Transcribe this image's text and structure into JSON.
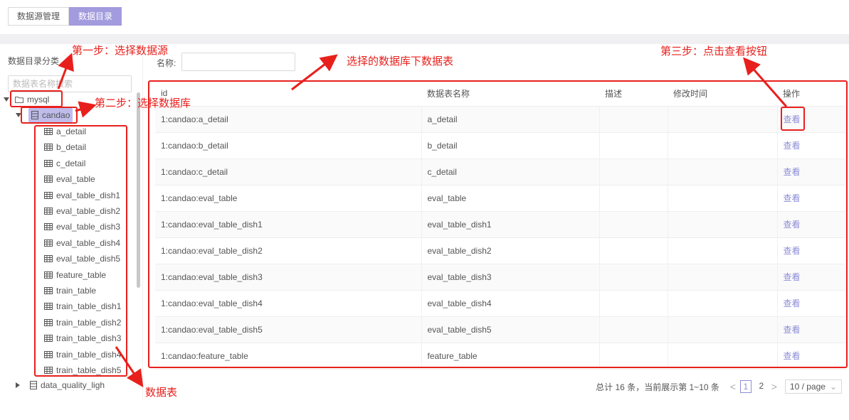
{
  "tabs": [
    {
      "label": "数据源管理",
      "active": false
    },
    {
      "label": "数据目录",
      "active": true
    }
  ],
  "sidebar": {
    "title": "数据目录分类",
    "search_placeholder": "数据表名称搜索",
    "datasource": "mysql",
    "database": "candao",
    "tables": [
      "a_detail",
      "b_detail",
      "c_detail",
      "eval_table",
      "eval_table_dish1",
      "eval_table_dish2",
      "eval_table_dish3",
      "eval_table_dish4",
      "eval_table_dish5",
      "feature_table",
      "train_table",
      "train_table_dish1",
      "train_table_dish2",
      "train_table_dish3",
      "train_table_dish4",
      "train_table_dish5"
    ],
    "other_database": "data_quality_ligh"
  },
  "filter": {
    "name_label": "名称:",
    "name_value": ""
  },
  "table": {
    "columns": [
      "id",
      "数据表名称",
      "描述",
      "修改时间",
      "操作"
    ],
    "action_label": "查看",
    "rows": [
      {
        "id": "1:candao:a_detail",
        "name": "a_detail",
        "desc": "",
        "modified": ""
      },
      {
        "id": "1:candao:b_detail",
        "name": "b_detail",
        "desc": "",
        "modified": ""
      },
      {
        "id": "1:candao:c_detail",
        "name": "c_detail",
        "desc": "",
        "modified": ""
      },
      {
        "id": "1:candao:eval_table",
        "name": "eval_table",
        "desc": "",
        "modified": ""
      },
      {
        "id": "1:candao:eval_table_dish1",
        "name": "eval_table_dish1",
        "desc": "",
        "modified": ""
      },
      {
        "id": "1:candao:eval_table_dish2",
        "name": "eval_table_dish2",
        "desc": "",
        "modified": ""
      },
      {
        "id": "1:candao:eval_table_dish3",
        "name": "eval_table_dish3",
        "desc": "",
        "modified": ""
      },
      {
        "id": "1:candao:eval_table_dish4",
        "name": "eval_table_dish4",
        "desc": "",
        "modified": ""
      },
      {
        "id": "1:candao:eval_table_dish5",
        "name": "eval_table_dish5",
        "desc": "",
        "modified": ""
      },
      {
        "id": "1:candao:feature_table",
        "name": "feature_table",
        "desc": "",
        "modified": ""
      }
    ]
  },
  "pagination": {
    "summary": "总计 16 条，当前展示第 1~10 条",
    "prev": "<",
    "next": ">",
    "pages": [
      "1",
      "2"
    ],
    "current_page": "1",
    "page_size": "10 / page"
  },
  "annotations": {
    "step1": "第一步：选择数据源",
    "step2": "第二步：选择数据库",
    "step3": "第三步：点击查看按钮",
    "tables_note": "选择的数据库下数据表",
    "datatable_label": "数据表"
  },
  "colors": {
    "accent": "#a29bde",
    "link": "#8c8cd8",
    "annotation": "#e8201c"
  },
  "icons": {
    "datasource": "folder-icon",
    "database": "database-icon",
    "table": "table-grid-icon"
  }
}
